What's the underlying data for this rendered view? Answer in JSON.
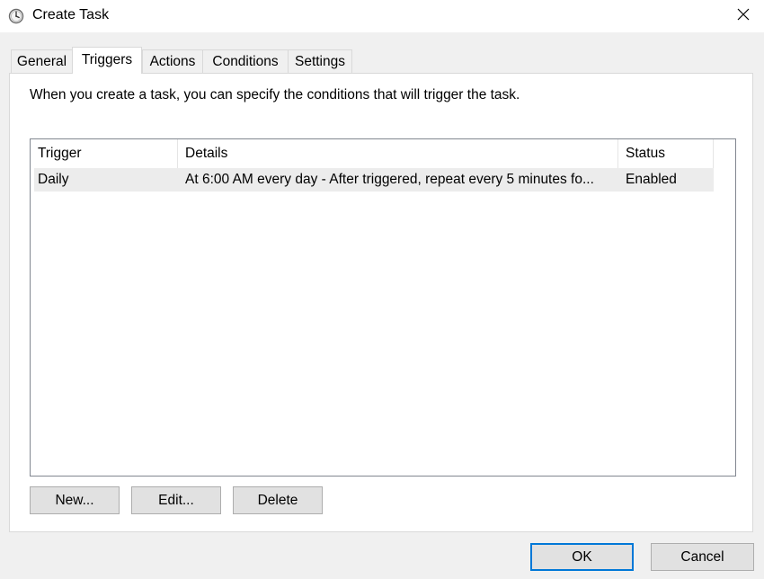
{
  "window": {
    "title": "Create Task",
    "icon": "clock-icon",
    "close_icon": "close-icon"
  },
  "tabs": [
    {
      "label": "General",
      "selected": false
    },
    {
      "label": "Triggers",
      "selected": true
    },
    {
      "label": "Actions",
      "selected": false
    },
    {
      "label": "Conditions",
      "selected": false
    },
    {
      "label": "Settings",
      "selected": false
    }
  ],
  "triggers": {
    "description": "When you create a task, you can specify the conditions that will trigger the task.",
    "columns": [
      "Trigger",
      "Details",
      "Status"
    ],
    "rows": [
      {
        "trigger": "Daily",
        "details": "At 6:00 AM every day - After triggered, repeat every 5 minutes fo...",
        "status": "Enabled"
      }
    ],
    "buttons": {
      "new": "New...",
      "edit": "Edit...",
      "delete": "Delete"
    }
  },
  "footer": {
    "ok": "OK",
    "cancel": "Cancel"
  },
  "colors": {
    "accent": "#0078d7",
    "selected_row": "#ececec",
    "dialog_bg": "#f0f0f0"
  }
}
